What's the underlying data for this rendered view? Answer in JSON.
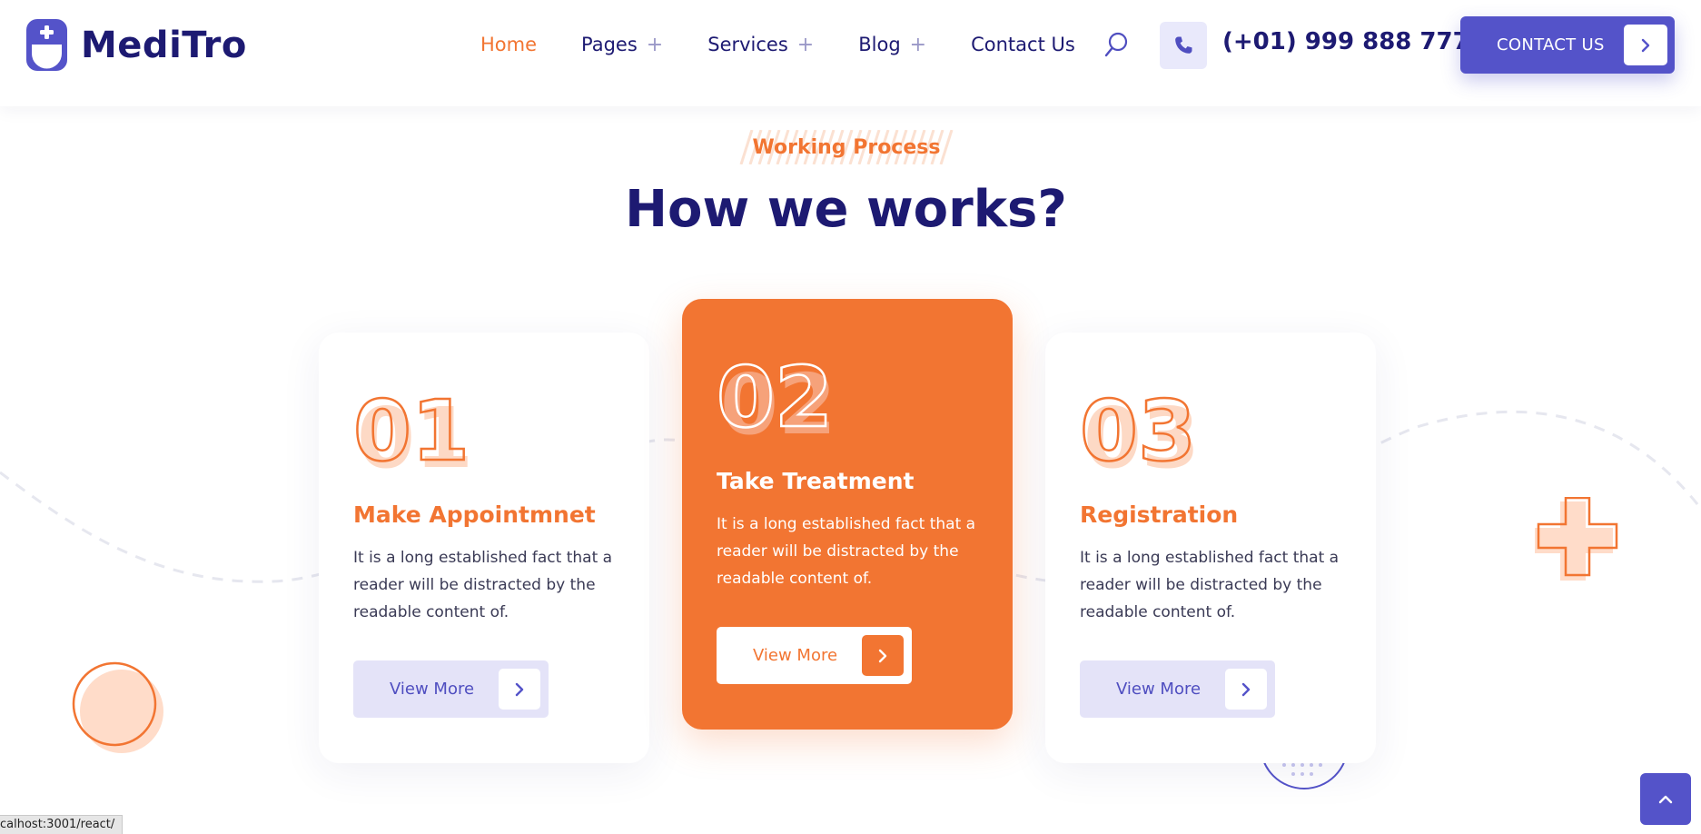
{
  "header": {
    "brand": "MediTro",
    "nav": [
      {
        "label": "Home",
        "has_plus": false,
        "active": true
      },
      {
        "label": "Pages",
        "has_plus": true,
        "active": false
      },
      {
        "label": "Services",
        "has_plus": true,
        "active": false
      },
      {
        "label": "Blog",
        "has_plus": true,
        "active": false
      },
      {
        "label": "Contact Us",
        "has_plus": false,
        "active": false
      }
    ],
    "plus_symbol": "+",
    "phone": "(+01) 999 888 777",
    "contact_button": "CONTACT US",
    "icons": {
      "logo": "logo-mark-icon",
      "search": "search-icon",
      "phone": "phone-icon",
      "arrow": "chevron-right-icon"
    }
  },
  "section": {
    "eyebrow": "Working Process",
    "title": "How we works?"
  },
  "cards": [
    {
      "number": "01",
      "title": "Make Appointmnet",
      "text": "It is a long established fact that a reader will be distracted by the readable content of.",
      "button": "View More",
      "active": false
    },
    {
      "number": "02",
      "title": "Take Treatment",
      "text": "It is a long established fact that a reader will be distracted by the readable content of.",
      "button": "View More",
      "active": true
    },
    {
      "number": "03",
      "title": "Registration",
      "text": "It is a long established fact that a reader will be distracted by the readable content of.",
      "button": "View More",
      "active": false
    }
  ],
  "status_bar": "calhost:3001/react/",
  "colors": {
    "primary": "#5453c9",
    "accent": "#f27532",
    "heading": "#1d1a72",
    "soft_purple": "#e4e3f8",
    "peach": "#ffd9c4"
  }
}
